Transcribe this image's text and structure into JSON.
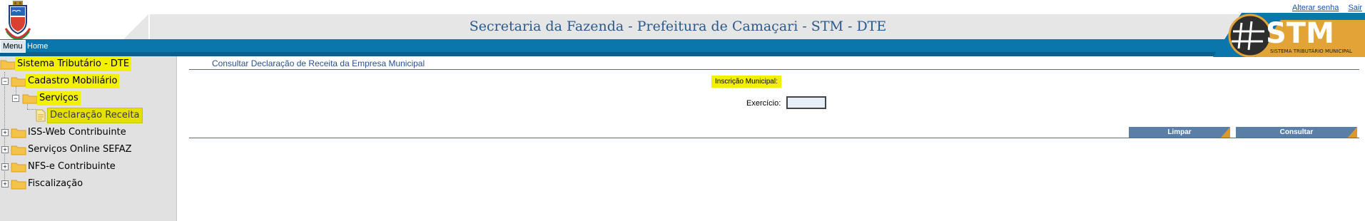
{
  "header": {
    "title": "Secretaria da Fazenda - Prefeitura de Camaçari - STM - DTE",
    "links": [
      "Alterar senha",
      "Sair"
    ],
    "logo_text": "STM",
    "logo_subtext": "SISTEMA TRIBUTÁRIO MUNICIPAL"
  },
  "menubar": {
    "menu_label": "Menu",
    "home_label": "Home"
  },
  "sidebar": {
    "root": "Sistema Tributário - DTE",
    "cadastro": "Cadastro Mobiliário",
    "servicos": "Serviços",
    "declaracao": "Declaração Receita",
    "iss": "ISS-Web Contribuinte",
    "servicos_online": "Serviços Online SEFAZ",
    "nfse": "NFS-e Contribuinte",
    "fiscalizacao": "Fiscalização",
    "toggle_expanded": "−",
    "toggle_collapsed": "+"
  },
  "main": {
    "heading": "Consultar Declaração de Receita da Empresa Municipal",
    "inscricao_label": "Inscrição Municipal:",
    "exercicio_label": "Exercício:",
    "exercicio_value": "",
    "limpar_label": "Limpar",
    "consultar_label": "Consultar"
  },
  "colors": {
    "menubar": "#0b76ab",
    "highlight": "#f3f000",
    "button": "#5a7fa6",
    "accent": "#d99a2b",
    "title": "#2a5a8c"
  }
}
